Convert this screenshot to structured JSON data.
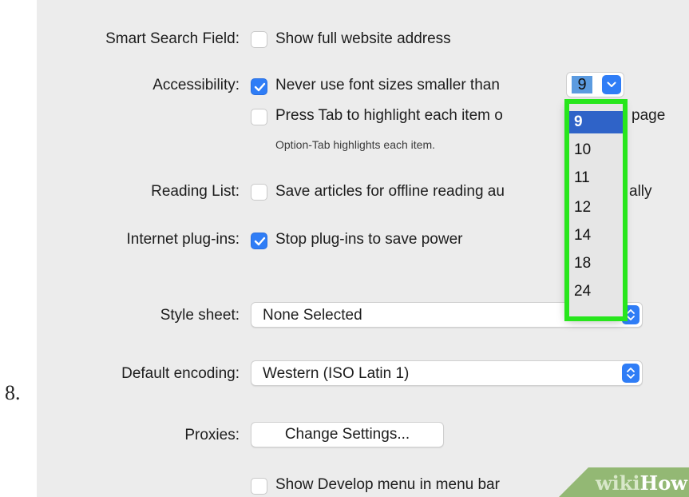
{
  "step_number": "8.",
  "colors": {
    "accent": "#2f7df6",
    "panel_bg": "#ececec",
    "highlight_border": "#27e61c",
    "dropdown_selected": "#2f63c8",
    "wikihow_green": "#93b874"
  },
  "smart_search": {
    "label": "Smart Search Field:",
    "option": "Show full website address",
    "checked": false
  },
  "accessibility": {
    "label": "Accessibility:",
    "option1": "Never use font sizes smaller than",
    "option1_checked": true,
    "font_size_value": "9",
    "option2": "Press Tab to highlight each item o",
    "option2_tail": "page",
    "option2_checked": false,
    "hint": "Option-Tab highlights each item."
  },
  "font_size_dropdown": {
    "options": [
      "9",
      "10",
      "11",
      "12",
      "14",
      "18",
      "24"
    ],
    "selected": "9"
  },
  "reading_list": {
    "label": "Reading List:",
    "option": "Save articles for offline reading au",
    "option_tail": "ally",
    "checked": false
  },
  "plugins": {
    "label": "Internet plug-ins:",
    "option": "Stop plug-ins to save power",
    "checked": true
  },
  "style_sheet": {
    "label": "Style sheet:",
    "value": "None Selected"
  },
  "encoding": {
    "label": "Default encoding:",
    "value": "Western (ISO Latin 1)"
  },
  "proxies": {
    "label": "Proxies:",
    "button": "Change Settings..."
  },
  "develop": {
    "option": "Show Develop menu in menu bar",
    "checked": false
  },
  "watermark": {
    "wiki": "wiki",
    "how": "How"
  }
}
